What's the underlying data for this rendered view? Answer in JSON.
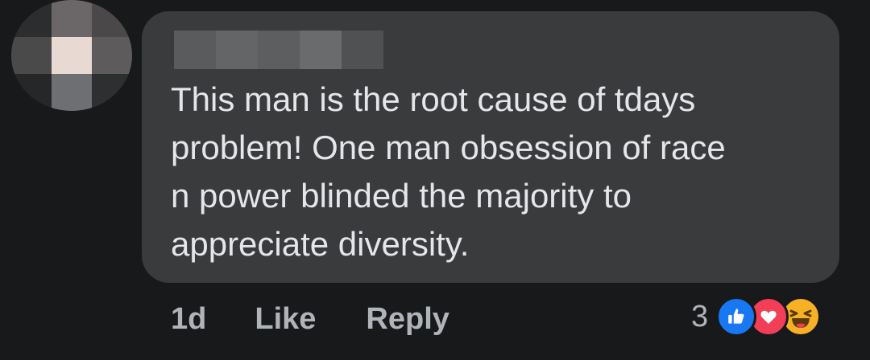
{
  "comment": {
    "text": "This man is the root cause of tdays\nproblem! One man obsession of race\nn power blinded the majority to\nappreciate diversity."
  },
  "actions": {
    "time": "1d",
    "like_label": "Like",
    "reply_label": "Reply"
  },
  "reactions": {
    "count": "3",
    "icons": [
      "like-reaction-icon",
      "love-reaction-icon",
      "haha-reaction-icon"
    ]
  },
  "colors": {
    "background": "#18191a",
    "bubble": "#3a3b3c",
    "text": "#e4e6eb",
    "secondary_text": "#b0b3b8",
    "like": "#1877f2",
    "love": "#f33e58",
    "haha": "#f7b125"
  }
}
